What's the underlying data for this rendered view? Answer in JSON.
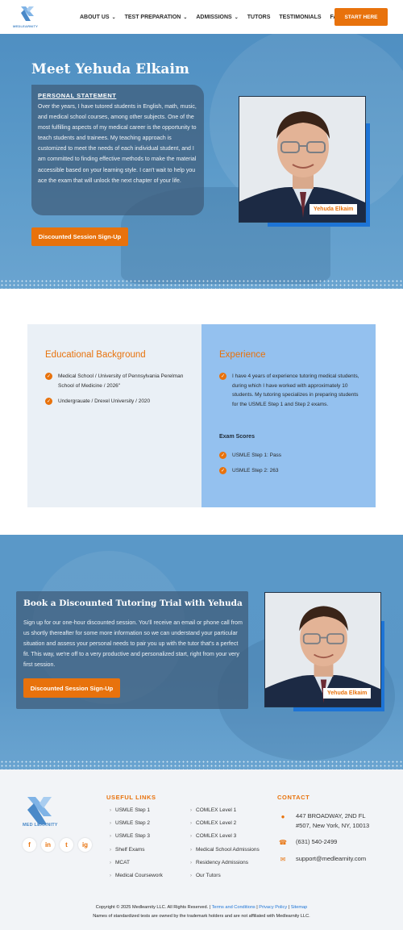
{
  "nav": {
    "logo_text": "MEDLEARNITY",
    "items": [
      {
        "label": "ABOUT US",
        "dropdown": true
      },
      {
        "label": "TEST PREPARATION",
        "dropdown": true
      },
      {
        "label": "ADMISSIONS",
        "dropdown": true
      },
      {
        "label": "TUTORS",
        "dropdown": false
      },
      {
        "label": "TESTIMONIALS",
        "dropdown": false
      },
      {
        "label": "FAQ",
        "dropdown": false
      }
    ],
    "cta": "START HERE"
  },
  "hero": {
    "title": "Meet Yehuda Elkaim",
    "statement_heading": "PERSONAL STATEMENT",
    "statement_text": "Over the years, I have tutored students in English, math, music, and medical school courses, among other subjects. One of the most fulfilling aspects of my medical career is the opportunity to teach students and trainees. My teaching approach is customized to meet the needs of each individual student, and I am committed to finding effective methods to make the material accessible based on your learning style. I can't wait to help you ace the exam that will unlock the next chapter of your life.",
    "cta": "Discounted Session Sign-Up",
    "name_badge": "Yehuda Elkaim"
  },
  "education": {
    "title": "Educational Background",
    "items": [
      "Medical School / University of Pennsylvania Perelman School of Medicine / 2026\"",
      "Undergrauate / Drexel University / 2020"
    ]
  },
  "experience": {
    "title": "Experience",
    "text": "I have 4 years of experience tutoring medical students, during which I have worked with approximately 10 students. My tutoring specializes in preparing students for the USMLE Step 1 and Step 2 exams.",
    "scores_title": "Exam Scores",
    "scores": [
      "USMLE Step 1: Pass",
      "USMLE Step 2: 263"
    ]
  },
  "book": {
    "title": "Book a Discounted Tutoring Trial with Yehuda",
    "text": "Sign up for our one-hour discounted session. You'll receive an email or phone call from us shortly thereafter for some more information so we can understand your particular situation and assess your personal needs to pair you up with the tutor that's a perfect fit. This way, we're off to a very productive and personalized start, right from your very first session.",
    "cta": "Discounted Session Sign-Up",
    "name_badge": "Yehuda Elkaim"
  },
  "footer": {
    "logo_text": "MED LEARNITY",
    "socials": [
      "f",
      "in",
      "t",
      "ig"
    ],
    "links_heading": "USEFUL LINKS",
    "links_col1": [
      "USMLE Step 1",
      "USMLE Step 2",
      "USMLE Step 3",
      "Shelf Exams",
      "MCAT",
      "Medical Coursework"
    ],
    "links_col2": [
      "COMLEX Level 1",
      "COMLEX Level 2",
      "COMLEX Level 3",
      "Medical School Admissions",
      "Residency Admissions",
      "Our Tutors"
    ],
    "contact_heading": "CONTACT",
    "address_line1": "447 BROADWAY, 2ND FL",
    "address_line2": "#507, New York, NY, 10013",
    "phone": "(631) 540-2499",
    "email": "support@medlearnity.com",
    "copyright": "Copyright © 2025 Medlearnity LLC. All Rights Reserved. |",
    "terms": "Terms and Conditions",
    "privacy": "Privacy Policy",
    "sitemap": "Sitemap",
    "disclaimer": "Names of standardized tests are owned by the trademark holders and are not affiliated with Medlearnity LLC."
  },
  "colors": {
    "accent": "#e8720c",
    "blue": "#1d74d6",
    "hero_blue": "#5b9ac9",
    "exp_blue": "#94c1ef"
  }
}
